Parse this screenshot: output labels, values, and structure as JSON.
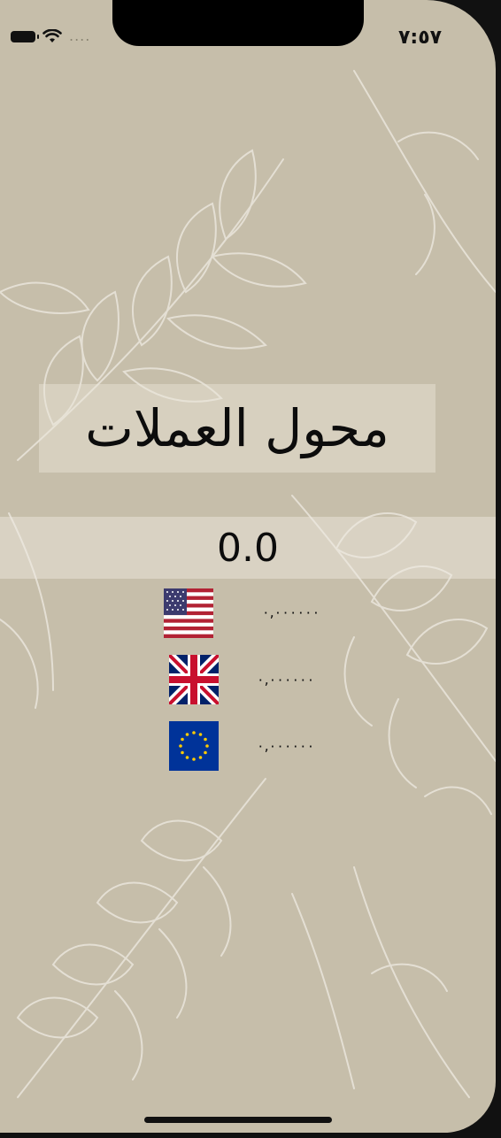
{
  "status_bar": {
    "time": "٧:٥٧",
    "signal": "....",
    "icons": [
      "battery-icon",
      "wifi-icon"
    ]
  },
  "app": {
    "title": "محول العملات",
    "value": "0.0"
  },
  "currencies": [
    {
      "flag": "us-flag-icon",
      "amount": "٠,٠٠٠٠٠٠"
    },
    {
      "flag": "uk-flag-icon",
      "amount": "٠,٠٠٠٠٠٠"
    },
    {
      "flag": "eu-flag-icon",
      "amount": "٠,٠٠٠٠٠٠"
    }
  ],
  "colors": {
    "background": "#c6beaa",
    "leaf_lines": "#efebe2"
  }
}
